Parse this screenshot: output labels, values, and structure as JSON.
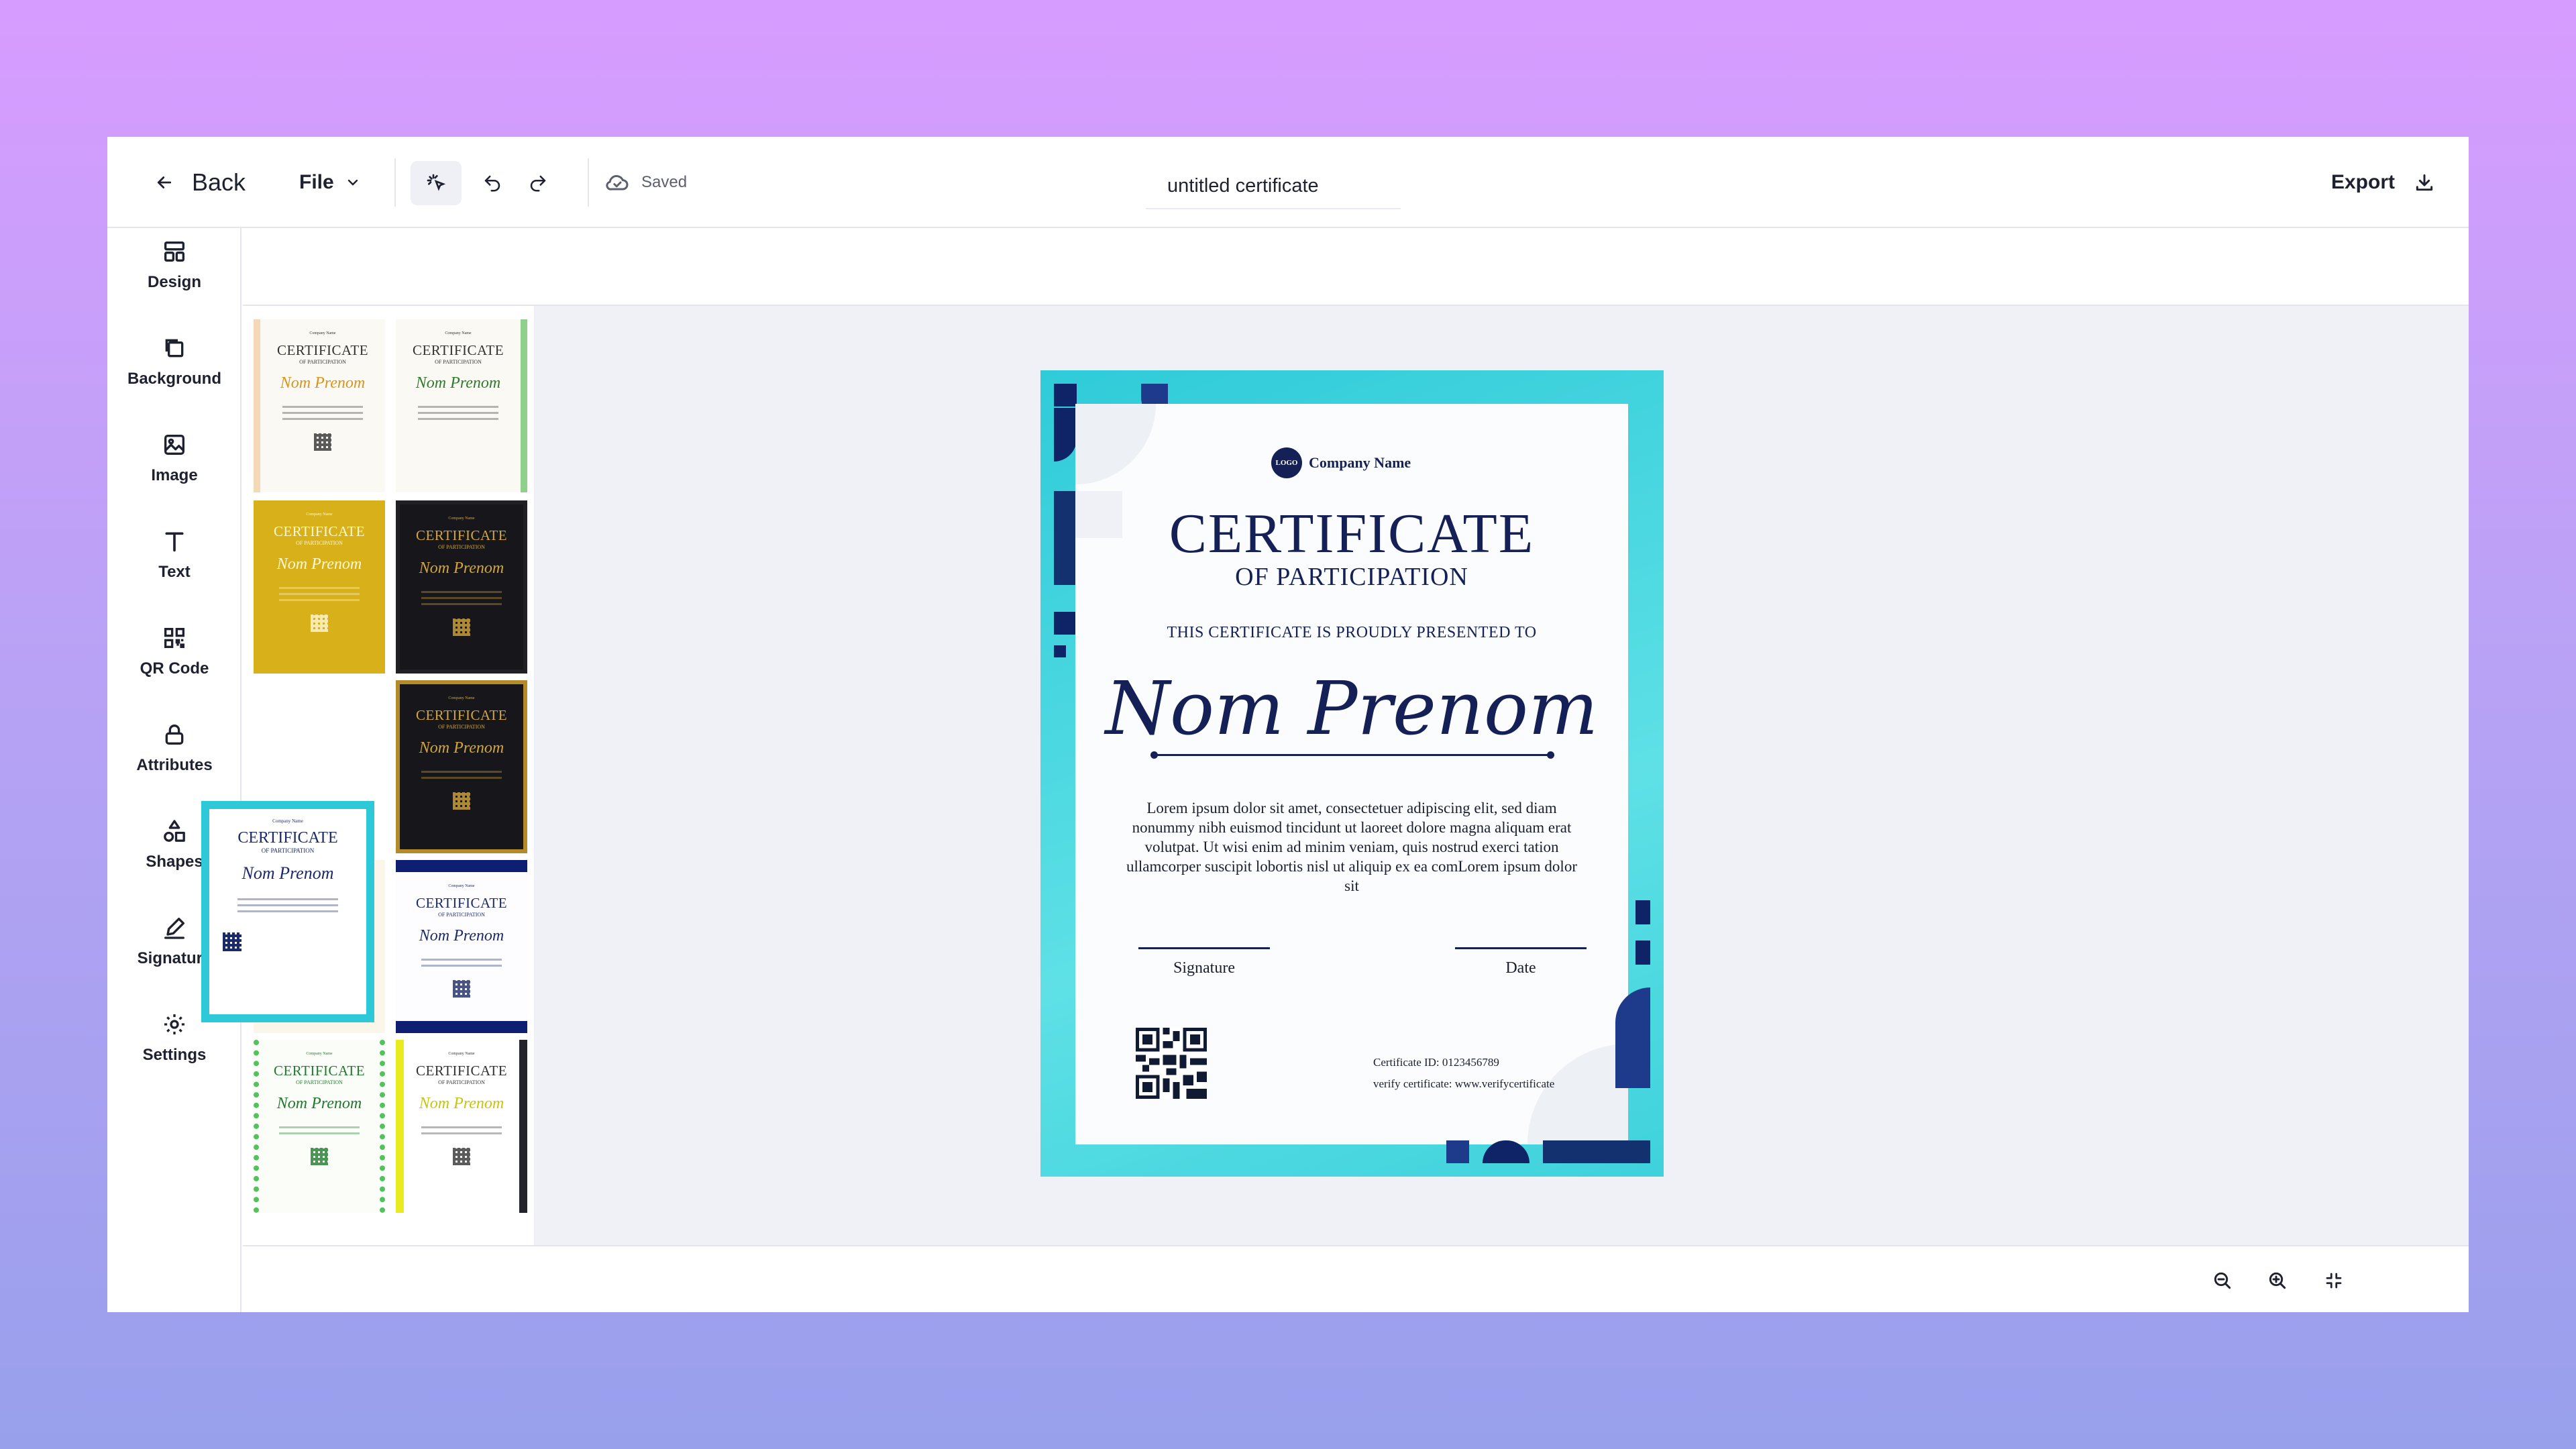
{
  "header": {
    "back_label": "Back",
    "file_label": "File",
    "save_status": "Saved",
    "document_title": "untitled certificate",
    "export_label": "Export"
  },
  "sidebar": {
    "items": [
      {
        "label": "Design",
        "icon": "layout-icon"
      },
      {
        "label": "Background",
        "icon": "background-icon"
      },
      {
        "label": "Image",
        "icon": "image-icon"
      },
      {
        "label": "Text",
        "icon": "text-icon"
      },
      {
        "label": "QR Code",
        "icon": "qr-code-icon"
      },
      {
        "label": "Attributes",
        "icon": "lock-icon"
      },
      {
        "label": "Shapes",
        "icon": "shapes-icon"
      },
      {
        "label": "Signature",
        "icon": "pen-icon"
      },
      {
        "label": "Settings",
        "icon": "gear-icon"
      }
    ]
  },
  "templates": {
    "title_text": "CERTIFICATE",
    "subtitle_text": "OF PARTICIPATION",
    "name_text": "Nom Prenom",
    "logo_text": "Company Name",
    "styles": [
      "light-orange",
      "light-green",
      "gold",
      "black-gold",
      "black-gold-frame",
      "cream",
      "navy",
      "green",
      "yellow-black"
    ],
    "selected_style": "turquoise-navy"
  },
  "certificate": {
    "logo_text": "LOGO",
    "company": "Company Name",
    "title": "CERTIFICATE",
    "subtitle": "OF PARTICIPATION",
    "presented_to": "THIS CERTIFICATE IS PROUDLY PRESENTED TO",
    "recipient": "Nom Prenom",
    "body": "Lorem ipsum dolor sit amet, consectetuer adipiscing elit, sed diam nonummy nibh euismod tincidunt ut laoreet dolore magna aliquam erat volutpat. Ut wisi enim ad minim veniam, quis nostrud exerci tation ullamcorper suscipit lobortis nisl ut aliquip ex ea comLorem ipsum dolor sit",
    "signature_label": "Signature",
    "date_label": "Date",
    "certificate_id": "Certificate ID: 0123456789",
    "verify_text": "verify certificate: www.verifycertificate",
    "colors": {
      "frame": "#2fcbd9",
      "ink": "#142056"
    }
  },
  "zoom_controls": [
    "zoom-out-icon",
    "zoom-in-icon",
    "fit-screen-icon"
  ]
}
